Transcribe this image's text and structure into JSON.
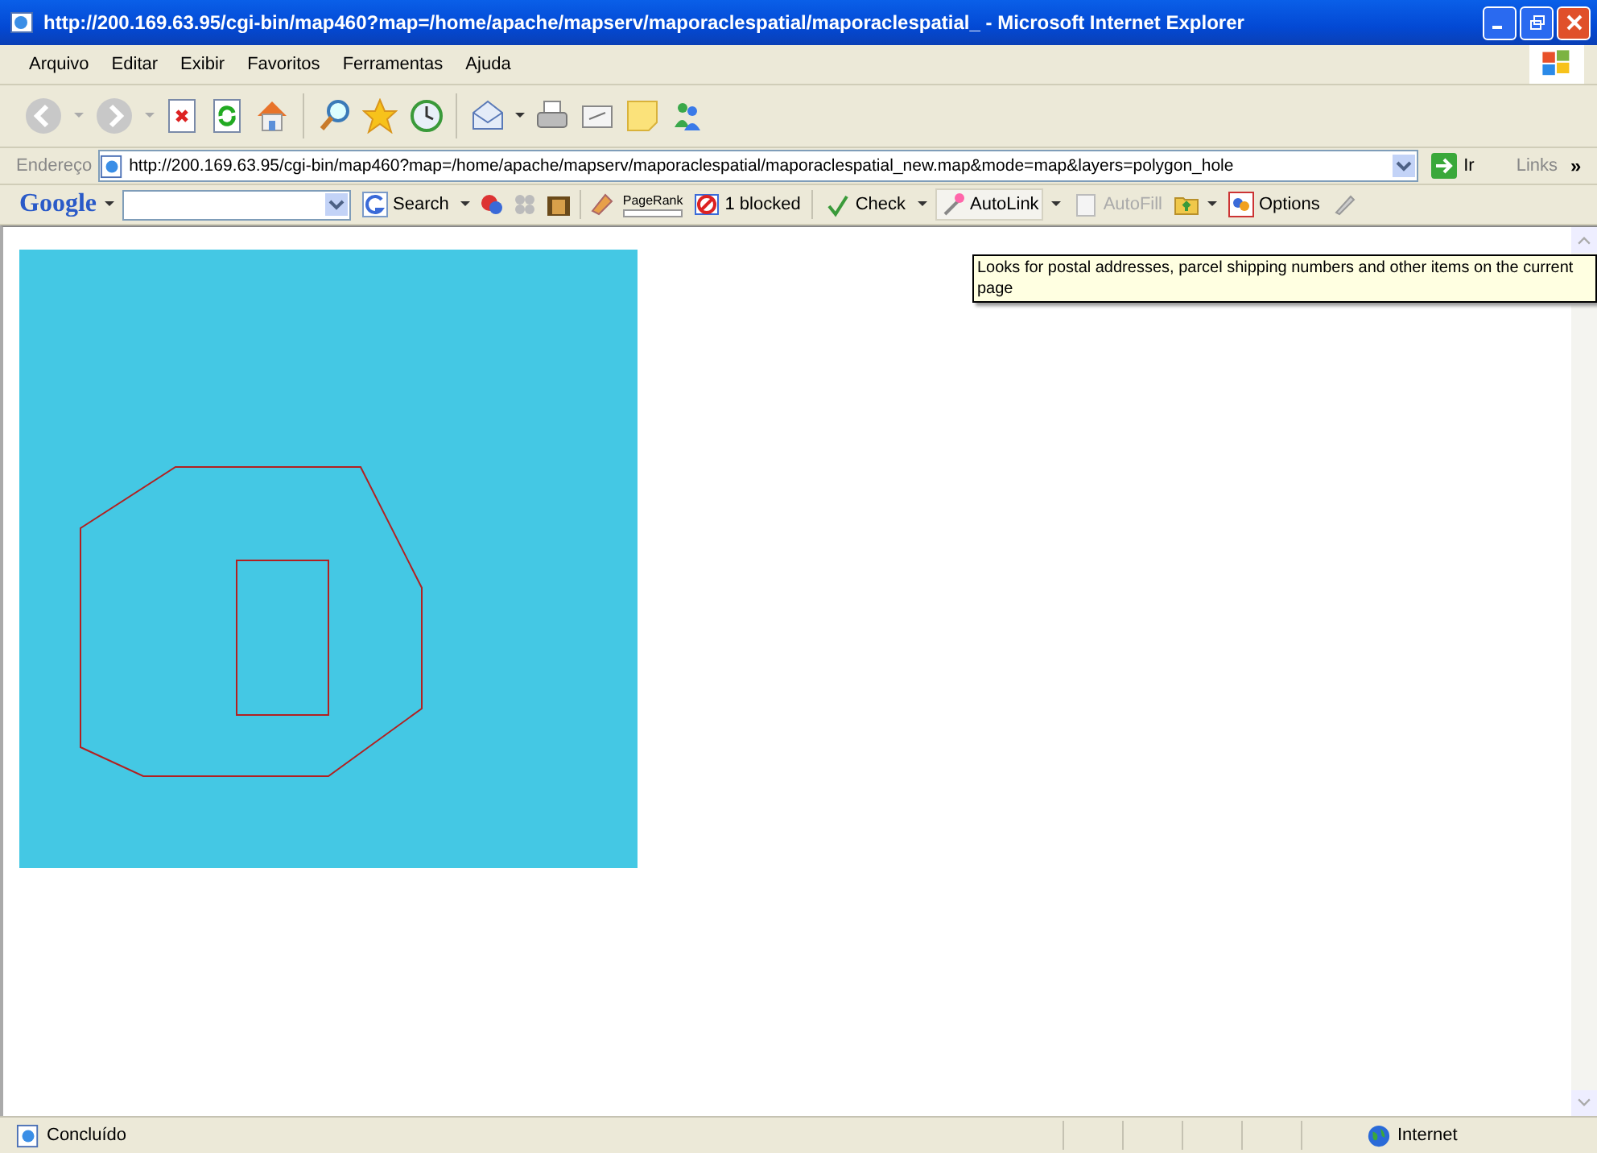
{
  "window": {
    "title": "http://200.169.63.95/cgi-bin/map460?map=/home/apache/mapserv/maporaclespatial/maporaclespatial_ - Microsoft Internet Explorer"
  },
  "menu": [
    "Arquivo",
    "Editar",
    "Exibir",
    "Favoritos",
    "Ferramentas",
    "Ajuda"
  ],
  "address_bar": {
    "label": "Endereço",
    "value": "http://200.169.63.95/cgi-bin/map460?map=/home/apache/mapserv/maporaclespatial/maporaclespatial_new.map&mode=map&layers=polygon_hole",
    "go": "Ir",
    "links": "Links",
    "more": "»"
  },
  "google_toolbar": {
    "logo": "Google",
    "search": "Search",
    "pagerank": "PageRank",
    "blocked": "1 blocked",
    "check": "Check",
    "autolink": "AutoLink",
    "autofill": "AutoFill",
    "options": "Options"
  },
  "tooltip": "Looks for postal addresses, parcel shipping numbers and other items on the current page",
  "status_bar": {
    "text": "Concluído",
    "zone": "Internet"
  }
}
